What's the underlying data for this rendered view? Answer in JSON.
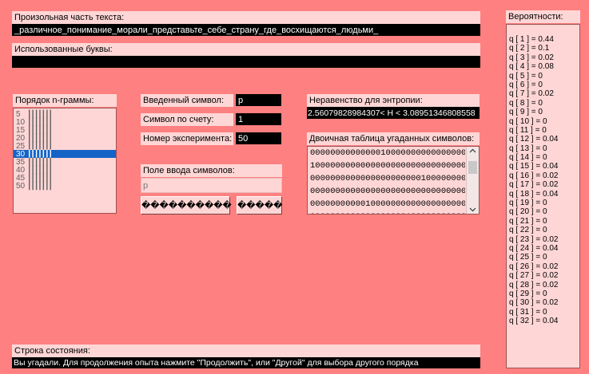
{
  "text_section": {
    "label": "Произольная часть текста:",
    "value": "_различное_понимание_морали_представьте_себе_страну_где_восхищаются_людьми_"
  },
  "used_letters": {
    "label": "Использованные буквы:",
    "value": ""
  },
  "ngram": {
    "label": "Порядок n-граммы:",
    "items": [
      "5",
      "10",
      "15",
      "20",
      "25",
      "30",
      "35",
      "40",
      "45",
      "50"
    ],
    "selected_index": 5
  },
  "fields": {
    "entered_label": "Введенный символ:",
    "entered_value": "р",
    "count_label": "Символ по счету:",
    "count_value": "1",
    "experiment_label": "Номер эксперимента:",
    "experiment_value": "50"
  },
  "input_section": {
    "label": "Поле ввода символов:",
    "placeholder": "р",
    "button1": "����������",
    "button2": "�����"
  },
  "entropy": {
    "label": "Неравенство для энтропии:",
    "value": "2.56079828984307< H < 3.08951346808558"
  },
  "binary_table": {
    "label": "Двоичная таблица угаданных символов:",
    "rows": [
      "00000000000000100000000000000000",
      "10000000000000000000000000000000",
      "00000000000000000000001000000000",
      "00000000000000000000000000000001",
      "00000000000100000000000000000000",
      "00000000000000000001000000000000"
    ]
  },
  "probabilities": {
    "label": "Вероятности:",
    "items": [
      "q [ 1 ] = 0.44",
      "q [ 2 ] = 0.1",
      "q [ 3 ] = 0.02",
      "q [ 4 ] = 0.08",
      "q [ 5 ] = 0",
      "q [ 6 ] = 0",
      "q [ 7 ] = 0.02",
      "q [ 8 ] = 0",
      "q [ 9 ] = 0",
      "q [ 10 ] = 0",
      "q [ 11 ] = 0",
      "q [ 12 ] = 0.04",
      "q [ 13 ] = 0",
      "q [ 14 ] = 0",
      "q [ 15 ] = 0.04",
      "q [ 16 ] = 0.02",
      "q [ 17 ] = 0.02",
      "q [ 18 ] = 0.04",
      "q [ 19 ] = 0",
      "q [ 20 ] = 0",
      "q [ 21 ] = 0",
      "q [ 22 ] = 0",
      "q [ 23 ] = 0.02",
      "q [ 24 ] = 0.04",
      "q [ 25 ] = 0",
      "q [ 26 ] = 0.02",
      "q [ 27 ] = 0.02",
      "q [ 28 ] = 0.02",
      "q [ 29 ] = 0",
      "q [ 30 ] = 0.02",
      "q [ 31 ] = 0",
      "q [ 32 ] = 0.04"
    ]
  },
  "status": {
    "label": "Строка состояния:",
    "value": "Вы угадали. Для продолжения опыта нажмите \"Продолжить\", или \"Другой\" для выбора другого порядка"
  }
}
